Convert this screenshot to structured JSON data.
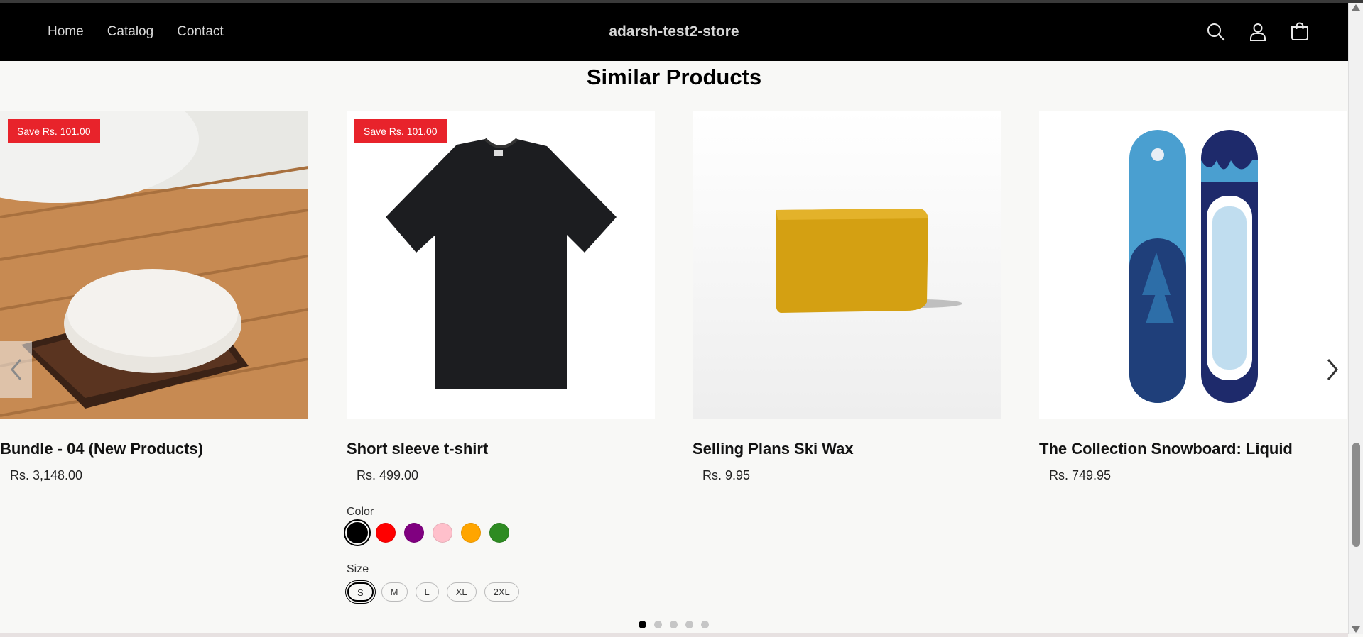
{
  "header": {
    "nav": [
      "Home",
      "Catalog",
      "Contact"
    ],
    "brand": "adarsh-test2-store",
    "icons": [
      "search-icon",
      "account-icon",
      "cart-icon"
    ]
  },
  "section": {
    "title": "Similar Products"
  },
  "products": [
    {
      "title": "Bundle - 04 (New Products)",
      "price": "Rs. 3,148.00",
      "badge": "Save Rs. 101.00",
      "image": "soap-on-wooden-dish"
    },
    {
      "title": "Short sleeve t-shirt",
      "price": "Rs. 499.00",
      "badge": "Save Rs. 101.00",
      "image": "black-t-shirt"
    },
    {
      "title": "Selling Plans Ski Wax",
      "price": "Rs. 9.95",
      "badge": "",
      "image": "yellow-wax-bar"
    },
    {
      "title": "The Collection Snowboard: Liquid",
      "price": "Rs. 749.95",
      "badge": "",
      "image": "blue-snowboards"
    }
  ],
  "options": {
    "color_label": "Color",
    "colors": [
      "#000000",
      "#ff0000",
      "#800080",
      "#ffc0cb",
      "#ffa500",
      "#2e8b22"
    ],
    "selected_color": "#000000",
    "size_label": "Size",
    "sizes": [
      "S",
      "M",
      "L",
      "XL",
      "2XL"
    ],
    "selected_size": "S"
  },
  "carousel": {
    "pages": 5,
    "current": 1
  }
}
